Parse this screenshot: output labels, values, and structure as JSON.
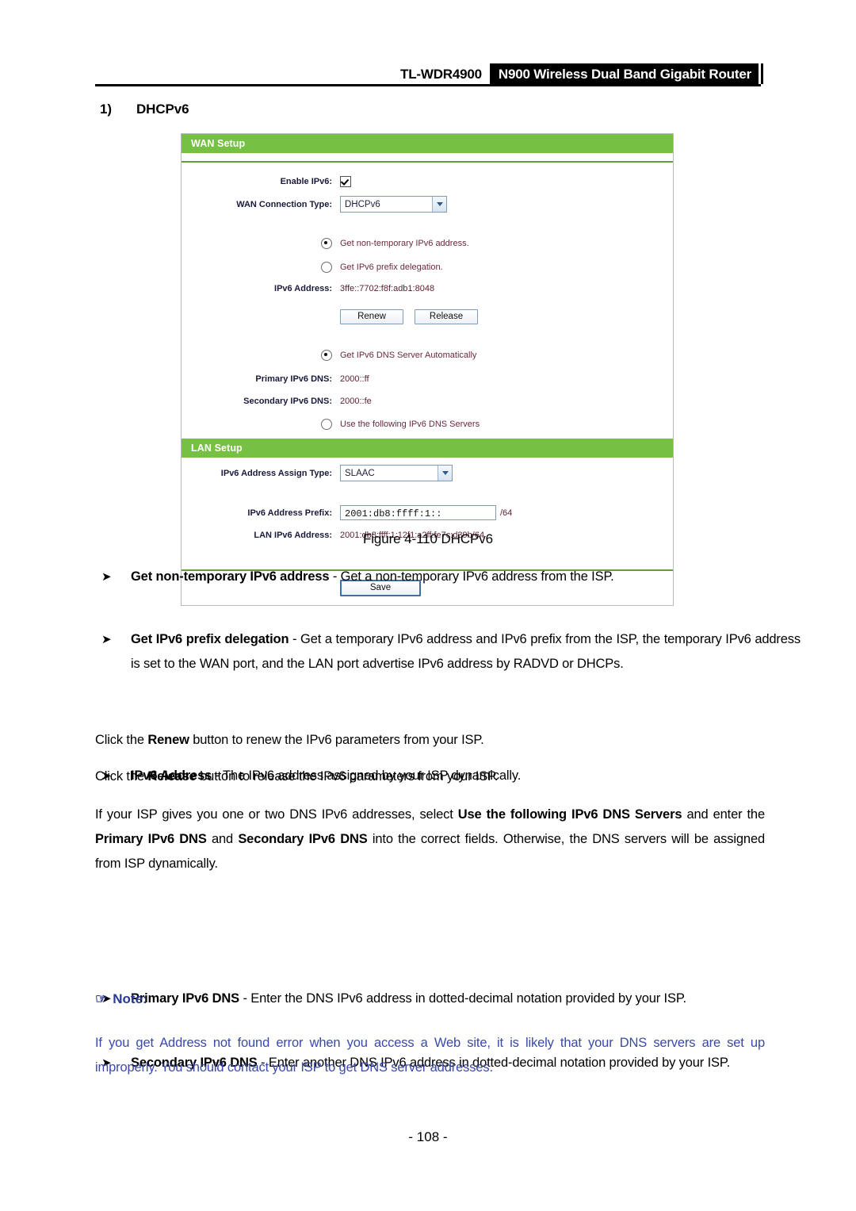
{
  "header": {
    "model": "TL-WDR4900",
    "product": "N900 Wireless Dual Band Gigabit Router"
  },
  "section": {
    "number": "1)",
    "title": "DHCPv6"
  },
  "panel": {
    "wan_bar": "WAN Setup",
    "lan_bar": "LAN Setup",
    "enable_ipv6_label": "Enable IPv6:",
    "enable_ipv6_checked": true,
    "wan_conn_type_label": "WAN Connection Type:",
    "wan_conn_type_value": "DHCPv6",
    "radio_nontemp": "Get non-temporary IPv6 address.",
    "radio_nontemp_selected": true,
    "radio_prefix_deleg": "Get IPv6 prefix delegation.",
    "radio_prefix_deleg_selected": false,
    "ipv6_address_label": "IPv6 Address:",
    "ipv6_address_value": "3ffe::7702:f8f:adb1:8048",
    "renew_button": "Renew",
    "release_button": "Release",
    "radio_dns_auto": "Get IPv6 DNS Server Automatically",
    "radio_dns_auto_selected": true,
    "primary_dns_label": "Primary IPv6 DNS:",
    "primary_dns_value": "2000::ff",
    "secondary_dns_label": "Secondary IPv6 DNS:",
    "secondary_dns_value": "2000::fe",
    "radio_dns_manual": "Use the following IPv6 DNS Servers",
    "radio_dns_manual_selected": false,
    "assign_type_label": "IPv6 Address Assign Type:",
    "assign_type_value": "SLAAC",
    "prefix_label": "IPv6 Address Prefix:",
    "prefix_value": "2001:db8:ffff:1::",
    "prefix_suffix": "/64",
    "lan_ipv6_label": "LAN IPv6 Address:",
    "lan_ipv6_value": "2001:db8:ffff:1:12f1:a2ff:fe7c:d39b/64",
    "save_button": "Save",
    "bar_color": "#76c044"
  },
  "figure": {
    "caption": "Figure 4-110 DHCPv6"
  },
  "body": {
    "bullet1_term": "Get non-temporary IPv6 address",
    "bullet1_rest": " - Get a non-temporary IPv6 address from the ISP.",
    "bullet2_term": "Get IPv6 prefix delegation",
    "bullet2_rest": " - Get a temporary IPv6 address and IPv6 prefix from the ISP, the temporary IPv6 address is set to the WAN port, and the LAN port advertise IPv6 address by RADVD or DHCPs.",
    "bullet3_term": "IPv6 Address",
    "bullet3_rest": " - The IPv6 address assigned by your ISP dynamically.",
    "para_renew_a": "Click the ",
    "para_renew_b": "Renew",
    "para_renew_c": " button to renew the IPv6 parameters from your ISP.",
    "para_release_a": "Click the ",
    "para_release_b": "Release",
    "para_release_c": " button to release the IPv6 parameters from your ISP.",
    "para_dns_1": "If your ISP gives you one or two DNS IPv6 addresses, select ",
    "para_dns_b1": "Use the following IPv6 DNS Servers",
    "para_dns_2": " and enter the ",
    "para_dns_b2": "Primary IPv6 DNS",
    "para_dns_3": " and ",
    "para_dns_b3": "Secondary IPv6 DNS",
    "para_dns_4": " into the correct fields. Otherwise, the DNS servers will be assigned from ISP dynamically.",
    "bullet4_term": "Primary IPv6 DNS",
    "bullet4_rest": " - Enter the DNS IPv6 address in dotted-decimal notation provided by your ISP.",
    "bullet5_term": "Secondary IPv6 DNS",
    "bullet5_rest": " - Enter another DNS IPv6 address in dotted-decimal notation provided by your ISP.",
    "bullet_marker": "➤"
  },
  "note": {
    "hand_icon": "☞",
    "label": "Note:",
    "text": "If you get Address not found error when you access a Web site, it is likely that your DNS servers are set up improperly. You should contact your ISP to get DNS server addresses.",
    "color": "#3a49ab"
  },
  "footer": {
    "page_number": "- 108 -"
  }
}
